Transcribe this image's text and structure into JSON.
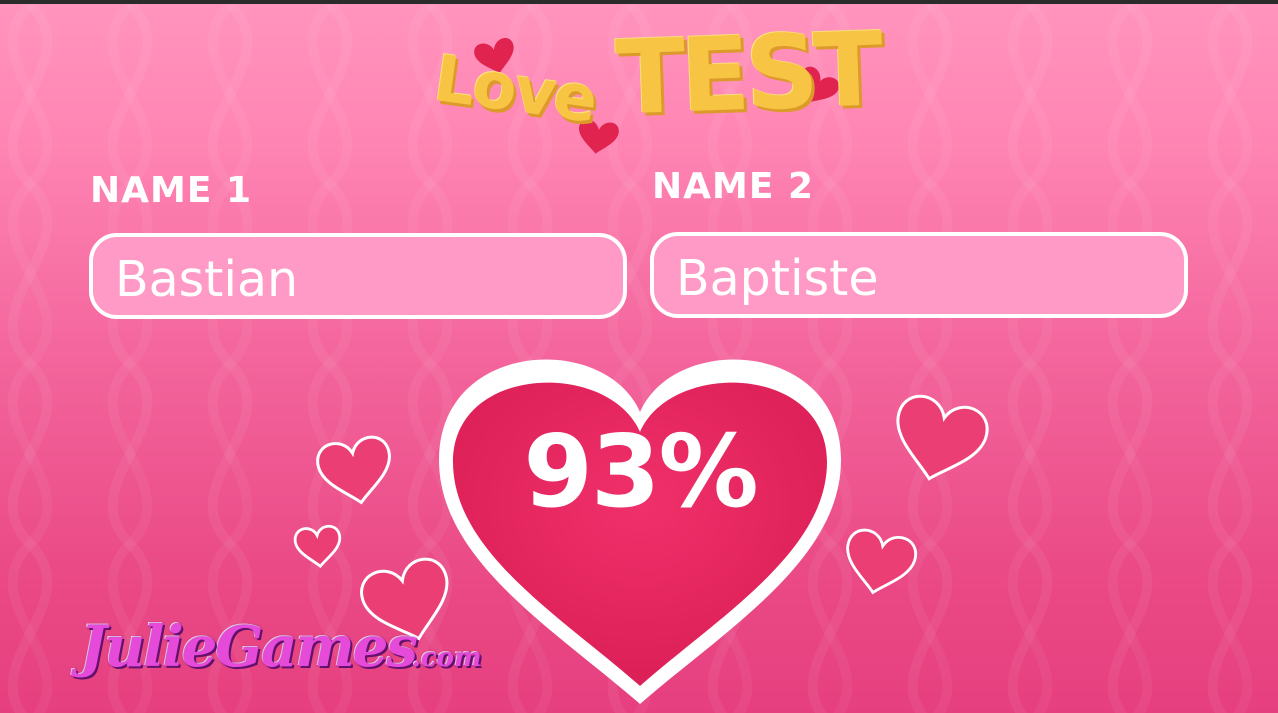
{
  "game": {
    "logo_word_1": "Love",
    "logo_word_2": "TEST",
    "name1": {
      "label": "NAME 1",
      "value": "Bastian"
    },
    "name2": {
      "label": "NAME 2",
      "value": "Baptiste"
    },
    "result": {
      "percent_text": "93%",
      "percent": 93
    },
    "brand": {
      "name": "JulieGames",
      "suffix": ".com"
    }
  },
  "colors": {
    "background_top": "#ff94bd",
    "background_bottom": "#e63f7f",
    "heart_fill": "#e8245e",
    "heart_outline": "#ffffff",
    "input_fill": "#ff9ac6",
    "logo_yellow": "#f8c444",
    "accent_red": "#e0234f",
    "brand_purple": "#e64ad8"
  },
  "icons": [
    "heart-icon"
  ]
}
